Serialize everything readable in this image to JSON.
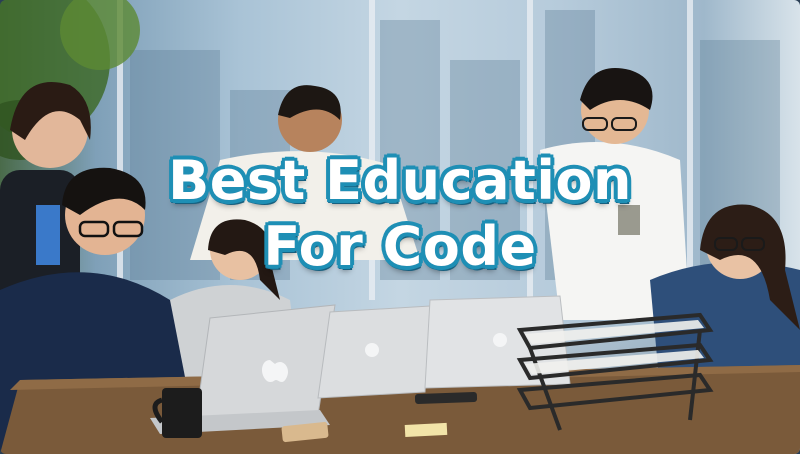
{
  "headline": {
    "line1": "Best Education",
    "line2": "For Code"
  },
  "colors": {
    "headline_fill": "#ffffff",
    "headline_outline": "#1e8fb5",
    "desk": "#7a5a3a",
    "window_light": "#c4d6e3"
  },
  "scene": {
    "description_icons": [
      "laptop-icon",
      "apple-logo-icon",
      "mug-icon",
      "paper-tray-icon",
      "phone-icon",
      "plant-icon"
    ]
  }
}
